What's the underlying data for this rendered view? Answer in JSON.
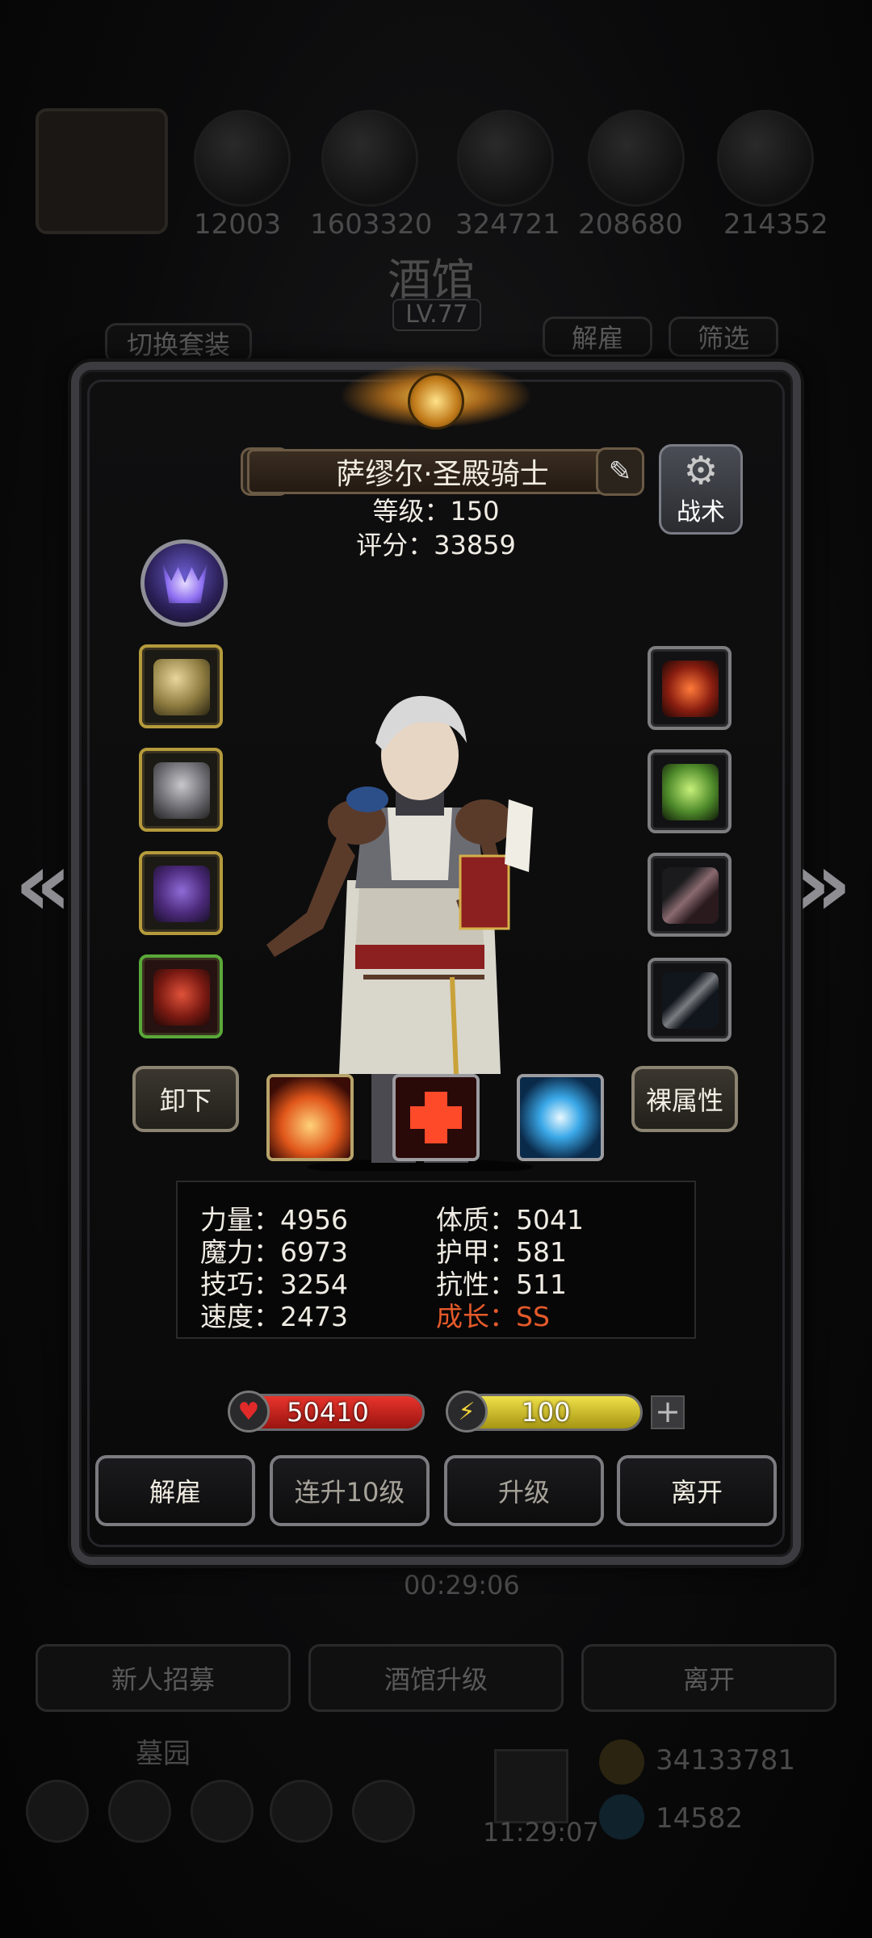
{
  "background": {
    "resource_numbers": [
      "12003",
      "1603320",
      "324721",
      "208680",
      "214352"
    ],
    "title": "酒馆",
    "level": "LV.77",
    "switch_outfit": "切换套装",
    "dismiss": "解雇",
    "filter": "筛选",
    "timer": "00:29:06",
    "recruit": "新人招募",
    "tavern_upgrade": "酒馆升级",
    "leave": "离开",
    "graveyard": "墓园",
    "clock": "11:29:07",
    "gold": "34133781",
    "gems": "14582"
  },
  "hero": {
    "name": "萨缪尔·圣殿骑士",
    "level_text": "等级：150",
    "score_text": "评分：33859",
    "tactics_label": "战术"
  },
  "equipment_left": [
    {
      "name": "hammer",
      "color": "#b59a3c"
    },
    {
      "name": "plate-armor",
      "color": "#b59a3c"
    },
    {
      "name": "purple-helm",
      "color": "#b59a3c"
    },
    {
      "name": "red-gauntlet",
      "color": "#5aa83a"
    }
  ],
  "equipment_right": [
    {
      "name": "flame-ring",
      "color": "#7d7d80"
    },
    {
      "name": "green-crystal",
      "color": "#7d7d80"
    },
    {
      "name": "feather-shard",
      "color": "#7d7d80"
    },
    {
      "name": "iron-mace",
      "color": "#7d7d80"
    }
  ],
  "buttons": {
    "unequip": "卸下",
    "bare_stats": "裸属性",
    "dismiss": "解雇",
    "upgrade10": "连升10级",
    "upgrade": "升级",
    "leave": "离开"
  },
  "attributes": {
    "strength": "力量：4956",
    "magic": "魔力：6973",
    "skill": "技巧：3254",
    "speed": "速度：2473",
    "constitution": "体质：5041",
    "armor": "护甲：581",
    "resistance": "抗性：511",
    "growth": "成长：SS"
  },
  "bars": {
    "hp": "50410",
    "energy": "100",
    "energy_plus": "+"
  },
  "colors": {
    "growth": "#e55a2a",
    "hp": "#c8201e",
    "energy": "#d6c51e",
    "gold_frame": "#b59a3c"
  }
}
